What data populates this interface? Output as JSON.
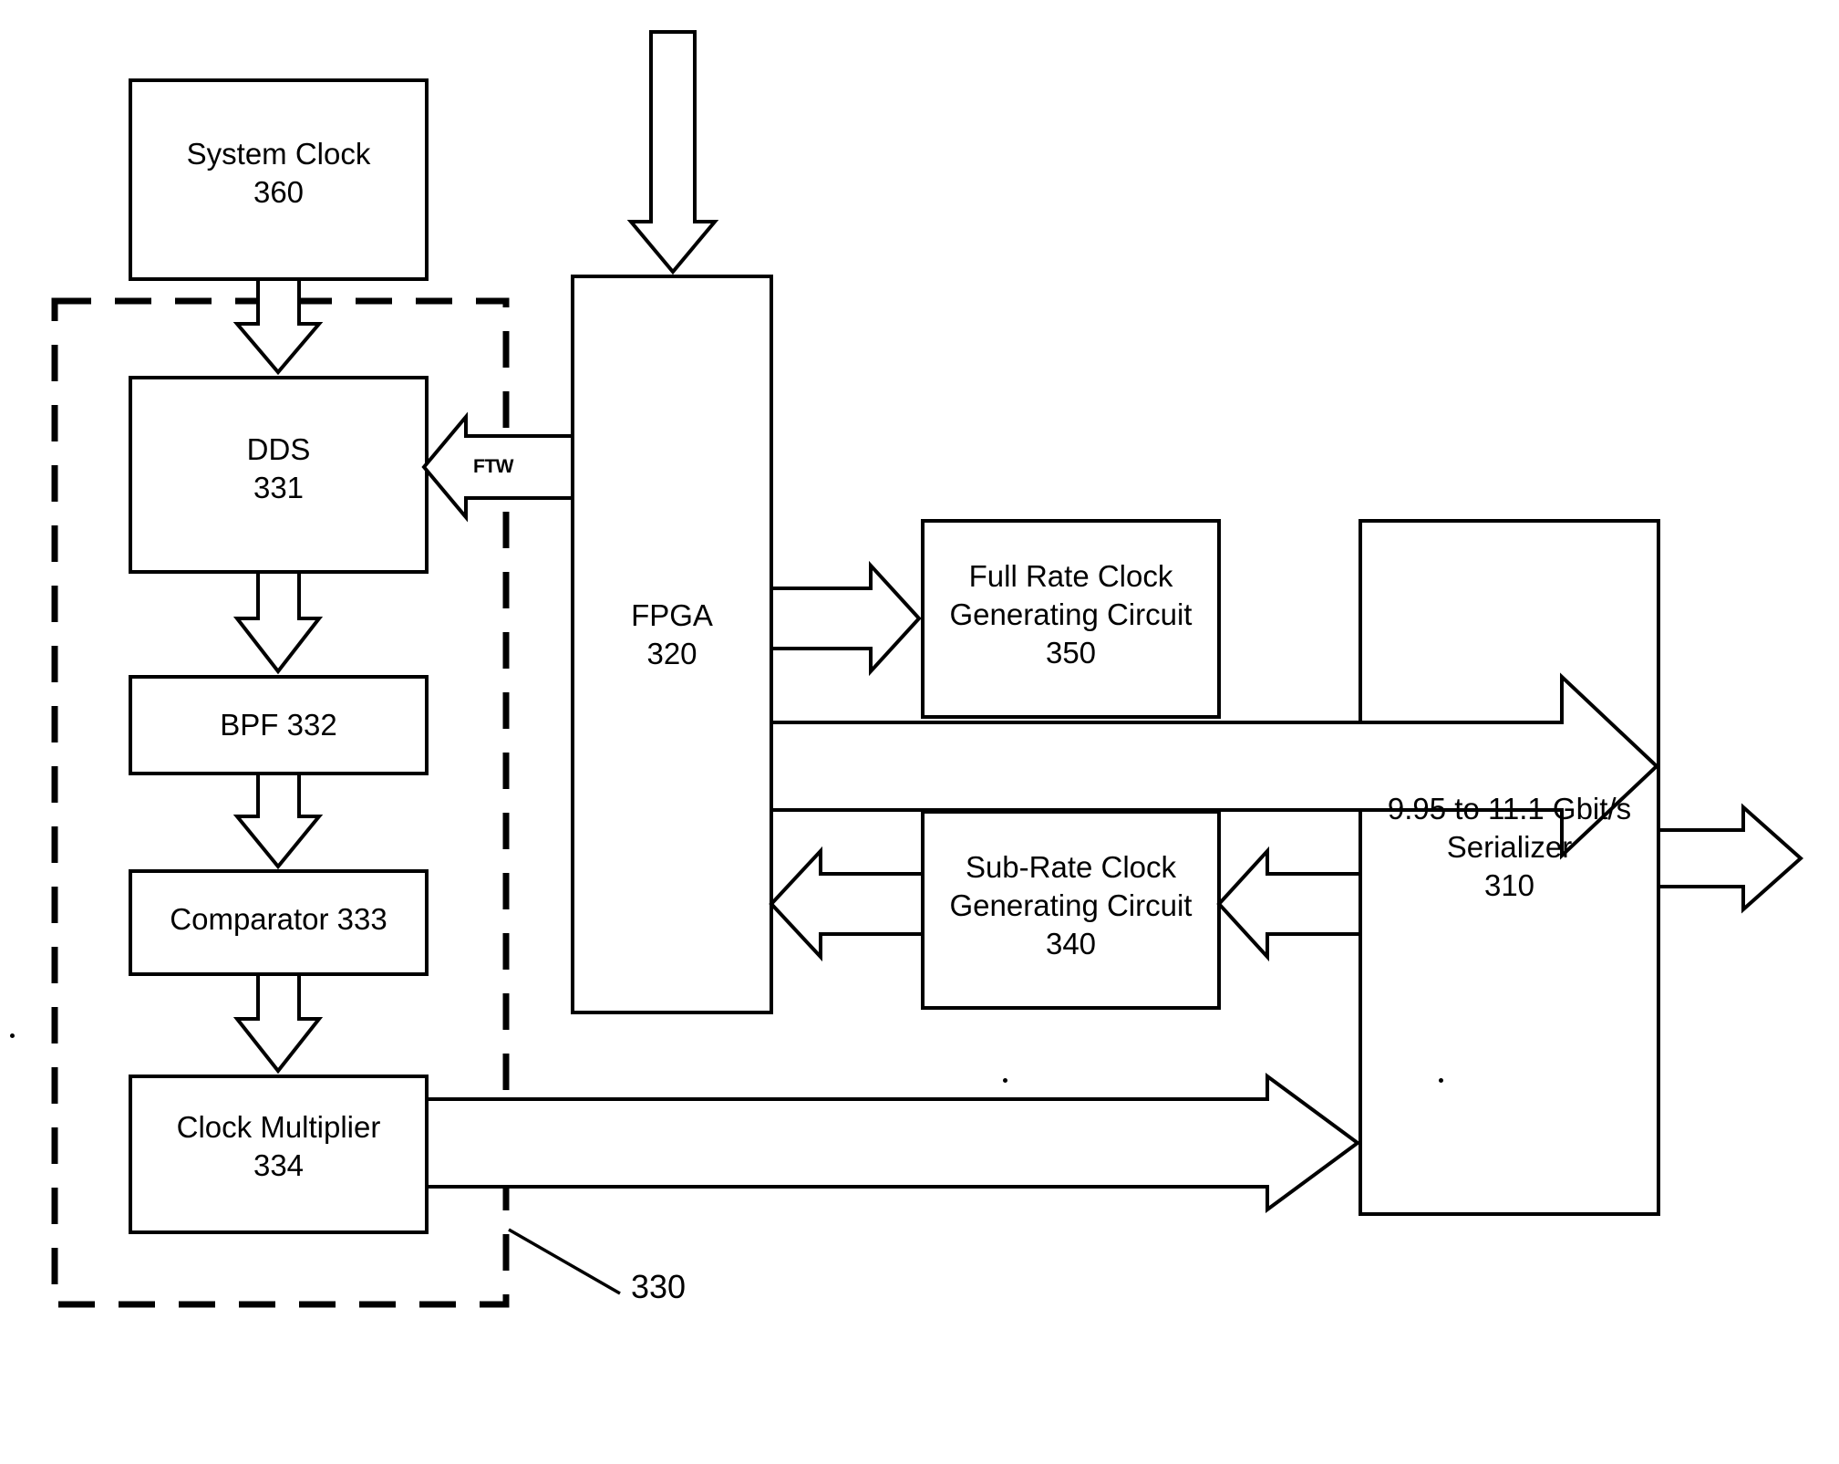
{
  "figure": {
    "type": "block-diagram",
    "background_color": "#ffffff",
    "line_color": "#000000"
  },
  "blocks": {
    "system_clock": {
      "label": "System Clock\n360",
      "name": "System Clock",
      "ref": "360"
    },
    "dds": {
      "label": "DDS\n331",
      "name": "DDS",
      "ref": "331"
    },
    "bpf": {
      "label": "BPF 332",
      "name": "BPF",
      "ref": "332"
    },
    "comparator": {
      "label": "Comparator 333",
      "name": "Comparator",
      "ref": "333"
    },
    "clock_multiplier": {
      "label": "Clock Multiplier\n334",
      "name": "Clock Multiplier",
      "ref": "334"
    },
    "fpga": {
      "label": "FPGA\n320",
      "name": "FPGA",
      "ref": "320"
    },
    "full_rate": {
      "label": "Full Rate Clock\nGenerating Circuit\n350",
      "name": "Full Rate Clock Generating Circuit",
      "ref": "350"
    },
    "sub_rate": {
      "label": "Sub-Rate Clock\nGenerating Circuit\n340",
      "name": "Sub-Rate Clock Generating Circuit",
      "ref": "340"
    },
    "serializer": {
      "label": "9.95 to 11.1 Gbit/s\nSerializer\n310",
      "name": "9.95 to 11.1 Gbit/s Serializer",
      "ref": "310"
    }
  },
  "annotations": {
    "ftw": "FTW",
    "group_ref": "330"
  }
}
